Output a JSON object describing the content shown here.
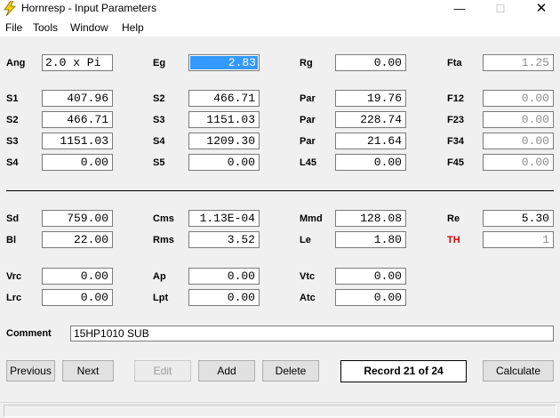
{
  "window": {
    "title": "Hornresp - Input Parameters",
    "min_symbol": "—",
    "max_symbol": "☐",
    "close_symbol": "✕",
    "app_icon": "lightning-bolt-icon"
  },
  "menu": {
    "file": "File",
    "tools": "Tools",
    "window": "Window",
    "help": "Help"
  },
  "params": {
    "ang": {
      "label": "Ang",
      "value": "2.0 x Pi"
    },
    "eg": {
      "label": "Eg",
      "value": "2.83"
    },
    "rg": {
      "label": "Rg",
      "value": "0.00"
    },
    "fta": {
      "label": "Fta",
      "value": "1.25"
    },
    "s1": {
      "label": "S1",
      "value": "407.96"
    },
    "s2_col2": {
      "label": "S2",
      "value": "466.71"
    },
    "par1": {
      "label": "Par",
      "value": "19.76"
    },
    "f12": {
      "label": "F12",
      "value": "0.00"
    },
    "s2": {
      "label": "S2",
      "value": "466.71"
    },
    "s3_col2": {
      "label": "S3",
      "value": "1151.03"
    },
    "par2": {
      "label": "Par",
      "value": "228.74"
    },
    "f23": {
      "label": "F23",
      "value": "0.00"
    },
    "s3": {
      "label": "S3",
      "value": "1151.03"
    },
    "s4_col2": {
      "label": "S4",
      "value": "1209.30"
    },
    "par3": {
      "label": "Par",
      "value": "21.64"
    },
    "f34": {
      "label": "F34",
      "value": "0.00"
    },
    "s4": {
      "label": "S4",
      "value": "0.00"
    },
    "s5": {
      "label": "S5",
      "value": "0.00"
    },
    "l45": {
      "label": "L45",
      "value": "0.00"
    },
    "f45": {
      "label": "F45",
      "value": "0.00"
    },
    "sd": {
      "label": "Sd",
      "value": "759.00"
    },
    "cms": {
      "label": "Cms",
      "value": "1.13E-04"
    },
    "mmd": {
      "label": "Mmd",
      "value": "128.08"
    },
    "re": {
      "label": "Re",
      "value": "5.30"
    },
    "bl": {
      "label": "Bl",
      "value": "22.00"
    },
    "rms": {
      "label": "Rms",
      "value": "3.52"
    },
    "le": {
      "label": "Le",
      "value": "1.80"
    },
    "th": {
      "label": "TH",
      "value": "1"
    },
    "vrc": {
      "label": "Vrc",
      "value": "0.00"
    },
    "ap": {
      "label": "Ap",
      "value": "0.00"
    },
    "vtc": {
      "label": "Vtc",
      "value": "0.00"
    },
    "lrc": {
      "label": "Lrc",
      "value": "0.00"
    },
    "lpt": {
      "label": "Lpt",
      "value": "0.00"
    },
    "atc": {
      "label": "Atc",
      "value": "0.00"
    }
  },
  "comment": {
    "label": "Comment",
    "value": "15HP1010 SUB"
  },
  "buttons": {
    "previous": "Previous",
    "next": "Next",
    "edit": "Edit",
    "add": "Add",
    "delete": "Delete",
    "calculate": "Calculate"
  },
  "record": "Record 21 of 24",
  "colors": {
    "selection": "#3399ff",
    "th_label": "#d00000"
  }
}
